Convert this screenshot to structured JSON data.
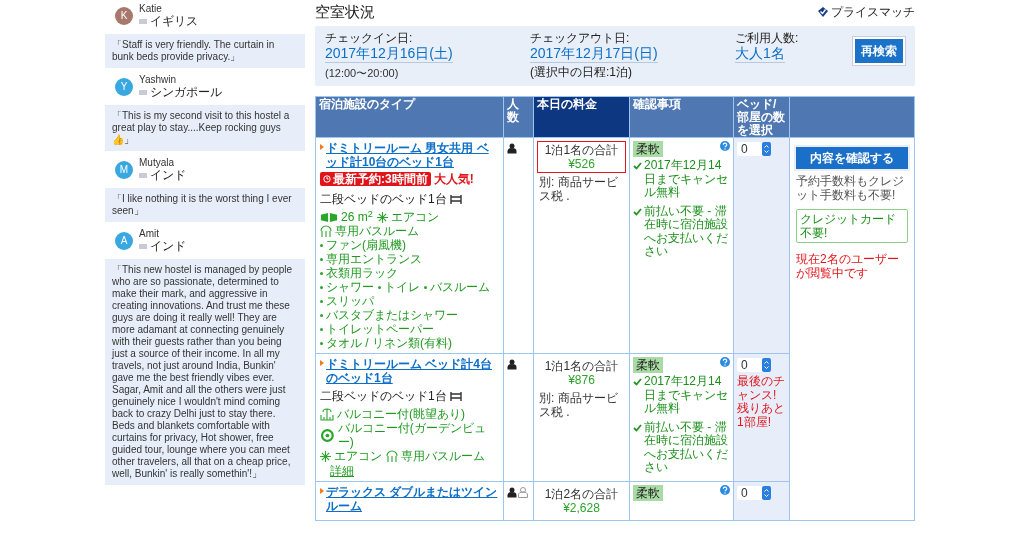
{
  "sidebar": {
    "items": [
      {
        "kind": "reviewer",
        "initial": "K",
        "color": "#a9786c",
        "name": "Katie",
        "country": "イギリス"
      },
      {
        "kind": "quote",
        "text": "「Staff is very friendly. The curtain in bunk beds provide privacy.」"
      },
      {
        "kind": "reviewer",
        "initial": "Y",
        "color": "#3aa8e0",
        "name": "Yashwin",
        "country": "シンガポール"
      },
      {
        "kind": "quote",
        "text": "「This is my second visit to this hostel a great play to stay....Keep rocking guys👍」"
      },
      {
        "kind": "reviewer",
        "initial": "M",
        "color": "#3aa8e0",
        "name": "Mutyala",
        "country": "インド"
      },
      {
        "kind": "quote",
        "text": "「I like nothing it is the worst thing I ever seen」"
      },
      {
        "kind": "reviewer",
        "initial": "A",
        "color": "#3aa8e0",
        "name": "Amit",
        "country": "インド"
      },
      {
        "kind": "quote",
        "text": "「This new hostel is managed by people who are so passionate, determined to make their mark, and aggressive in creating innovations. And trust me these guys are doing it really well! They are more adamant at connecting genuinely with their guests rather than you being just a source of their income. In all my travels, not just around India, Bunkin' gave me the best friendly vibes ever. Sagar, Amit and all the others were just genuinely nice I wouldn't mind coming back to crazy Delhi just to stay there. Beds and blankets comfortable with curtains for privacy, Hot shower, free guided tour, lounge where you can meet other travelers, all that on a cheap price, well, Bunkin' is really somethin'!」"
      }
    ]
  },
  "title": "空室状況",
  "price_match": "プライスマッチ",
  "search": {
    "checkin_label": "チェックイン日:",
    "checkin": "2017年12月16日(土)",
    "checkin_note": "(12:00〜20:00)",
    "checkout_label": "チェックアウト日:",
    "checkout": "2017年12月17日(日)",
    "checkout_note": "(選択中の日程:1泊)",
    "guests_label": "ご利用人数:",
    "guests": "大人1名",
    "button": "再検索"
  },
  "table": {
    "columns": [
      "宿泊施設のタイプ",
      "人数",
      "本日の料金",
      "確認事項",
      "ベッド/部屋の数を選択"
    ],
    "rows": [
      {
        "name": "ドミトリールーム 男女共用 ベッド計10台のベッド1台",
        "recent": "最新予約:3時間前",
        "popular": "大人気!",
        "bed": "二段ベッドのベッド1台",
        "amenities": [
          [
            {
              "kind": "area",
              "text": "26 m$^{2}$"
            },
            {
              "kind": "ac",
              "text": "エアコン"
            }
          ],
          [
            {
              "kind": "bath",
              "text": "専用バスルーム"
            }
          ],
          [
            {
              "kind": "bullet",
              "text": "ファン(扇風機)"
            }
          ],
          [
            {
              "kind": "bullet",
              "text": "専用エントランス"
            },
            {
              "kind": "bullet",
              "text": "衣類用ラック"
            }
          ],
          [
            {
              "kind": "bullet",
              "text": "シャワー"
            },
            {
              "kind": "bullet",
              "text": "トイレ"
            },
            {
              "kind": "bullet",
              "text": "バスルーム"
            }
          ],
          [
            {
              "kind": "bullet",
              "text": "スリッパ"
            }
          ],
          [
            {
              "kind": "bullet",
              "text": "バスタブまたはシャワー"
            }
          ],
          [
            {
              "kind": "bullet",
              "text": "トイレットペーパー"
            }
          ],
          [
            {
              "kind": "bullet",
              "text": "タオル / リネン類(有料)"
            }
          ]
        ],
        "guests": [
          {
            "filled": true
          }
        ],
        "price_label": "1泊1名の合計",
        "price": "¥526",
        "highlighted": true,
        "tax": "別: 商品サービス税 .",
        "badge": "柔軟",
        "conditions": [
          "2017年12月14日までキャンセル無料",
          "前払い不要 - 滞在時に宿泊施設へお支払いください"
        ],
        "count": "0"
      },
      {
        "name": "ドミトリールーム ベッド計4台のベッド1台",
        "bed": "二段ベッドのベッド1台",
        "amenities": [
          [
            {
              "kind": "balcony",
              "text": "バルコニー付(眺望あり)"
            }
          ],
          [
            {
              "kind": "view",
              "text": "バルコニー付(ガーデンビュー)"
            }
          ],
          [
            {
              "kind": "ac",
              "text": "エアコン"
            },
            {
              "kind": "bath",
              "text": "専用バスルーム"
            }
          ]
        ],
        "details": "詳細",
        "guests": [
          {
            "filled": true
          }
        ],
        "price_label": "1泊1名の合計",
        "price": "¥876",
        "highlighted": false,
        "tax": "別: 商品サービス税 .",
        "badge": "柔軟",
        "conditions": [
          "2017年12月14日までキャンセル無料",
          "前払い不要 - 滞在時に宿泊施設へお支払いください"
        ],
        "count": "0",
        "warning": "最後のチャンス! 残りあと1部屋!"
      },
      {
        "name": "デラックス ダブルまたはツインルーム",
        "guests": [
          {
            "filled": true
          },
          {
            "filled": false
          }
        ],
        "price_label": "1泊2名の合計",
        "price": "¥2,628",
        "highlighted": false,
        "badge": "柔軟",
        "count": "0"
      }
    ]
  },
  "action": {
    "button": "内容を確認する",
    "fee_note": "予約手数料もクレジット手数料も不要!",
    "card_note": "クレジットカード不要!",
    "viewers": "現在2名のユーザーが閲覧中です"
  }
}
